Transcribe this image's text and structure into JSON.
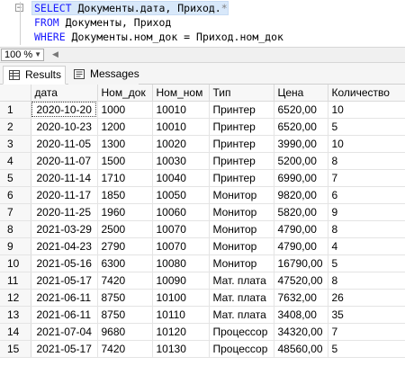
{
  "editor": {
    "lines": [
      {
        "kw": "SELECT",
        "rest": " Документы.дата, Приход.",
        "tail": "*"
      },
      {
        "kw": "FROM",
        "rest": " Документы, Приход",
        "tail": ""
      },
      {
        "kw": "WHERE",
        "rest": " Документы.ном_док = Приход.ном_док",
        "tail": ""
      }
    ]
  },
  "zoom": {
    "value": "100 %"
  },
  "tabs": [
    {
      "label": "Results",
      "icon": "grid-icon"
    },
    {
      "label": "Messages",
      "icon": "messages-icon"
    }
  ],
  "table": {
    "columns": [
      "дата",
      "Ном_док",
      "Ном_ном",
      "Тип",
      "Цена",
      "Количество"
    ],
    "rows": [
      [
        "1",
        "2020-10-20",
        "1000",
        "10010",
        "Принтер",
        "6520,00",
        "10"
      ],
      [
        "2",
        "2020-10-23",
        "1200",
        "10010",
        "Принтер",
        "6520,00",
        "5"
      ],
      [
        "3",
        "2020-11-05",
        "1300",
        "10020",
        "Принтер",
        "3990,00",
        "10"
      ],
      [
        "4",
        "2020-11-07",
        "1500",
        "10030",
        "Принтер",
        "5200,00",
        "8"
      ],
      [
        "5",
        "2020-11-14",
        "1710",
        "10040",
        "Принтер",
        "6990,00",
        "7"
      ],
      [
        "6",
        "2020-11-17",
        "1850",
        "10050",
        "Монитор",
        "9820,00",
        "6"
      ],
      [
        "7",
        "2020-11-25",
        "1960",
        "10060",
        "Монитор",
        "5820,00",
        "9"
      ],
      [
        "8",
        "2021-03-29",
        "2500",
        "10070",
        "Монитор",
        "4790,00",
        "8"
      ],
      [
        "9",
        "2021-04-23",
        "2790",
        "10070",
        "Монитор",
        "4790,00",
        "4"
      ],
      [
        "10",
        "2021-05-16",
        "6300",
        "10080",
        "Монитор",
        "16790,00",
        "5"
      ],
      [
        "11",
        "2021-05-17",
        "7420",
        "10090",
        "Мат. плата",
        "47520,00",
        "8"
      ],
      [
        "12",
        "2021-06-11",
        "8750",
        "10100",
        "Мат. плата",
        "7632,00",
        "26"
      ],
      [
        "13",
        "2021-06-11",
        "8750",
        "10110",
        "Мат. плата",
        "3408,00",
        "35"
      ],
      [
        "14",
        "2021-07-04",
        "9680",
        "10120",
        "Процессор",
        "34320,00",
        "7"
      ],
      [
        "15",
        "2021-05-17",
        "7420",
        "10130",
        "Процессор",
        "48560,00",
        "5"
      ]
    ]
  }
}
